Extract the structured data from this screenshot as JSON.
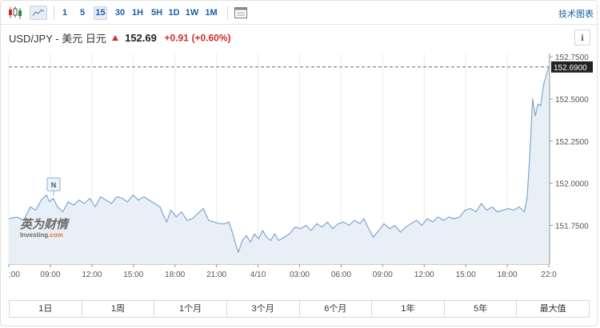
{
  "toolbar": {
    "intervals": [
      "1",
      "5",
      "15",
      "30",
      "1H",
      "5H",
      "1D",
      "1W",
      "1M"
    ],
    "active_interval": "15",
    "tech_chart_label": "技术图表"
  },
  "header": {
    "pair": "USD/JPY - 美元 日元",
    "price": "152.69",
    "change": "+0.91",
    "change_pct": "(+0.60%)",
    "info_label": "i"
  },
  "watermark": {
    "brand_cn": "英为财情",
    "brand_en": "Investing",
    "brand_suffix": ".com"
  },
  "news_marker": "N",
  "ranges": [
    "1日",
    "1周",
    "1个月",
    "3个月",
    "6个月",
    "1年",
    "5年",
    "最大值"
  ],
  "colors": {
    "line": "#7fa6cf",
    "fill": "#e9eff6",
    "up": "#d12b2b",
    "accent": "#1a5fa8",
    "last_price_bg": "#222222"
  },
  "chart_data": {
    "type": "area",
    "x_labels": [
      ":00",
      "09:00",
      "12:00",
      "15:00",
      "18:00",
      "21:00",
      "4/10",
      "03:00",
      "06:00",
      "09:00",
      "12:00",
      "15:00",
      "18:00",
      "22:0"
    ],
    "y_ticks": [
      "152.7500",
      "152.5000",
      "152.2500",
      "152.0000",
      "151.7500"
    ],
    "ylim": [
      151.52,
      152.77
    ],
    "last_price": "152.6900",
    "last_price_value": 152.69,
    "grid": "vertical",
    "x_unit": "hours from first label",
    "x_range": [
      0,
      40
    ],
    "series": [
      {
        "x": [
          0,
          0.6,
          1.1,
          1.6,
          2.0,
          2.4,
          2.8,
          3.0,
          3.3,
          3.6,
          4.0,
          4.4,
          4.8,
          5.2,
          5.6,
          6.0,
          6.4,
          6.8,
          7.2,
          7.6,
          8.0,
          8.4,
          8.8,
          9.2,
          9.6,
          10.0,
          10.4,
          10.8,
          11.2,
          11.4,
          11.7,
          12.0,
          12.4,
          12.8,
          13.2,
          13.6,
          14.0,
          14.4,
          14.8,
          15.2,
          15.6,
          16.0,
          16.3,
          16.6,
          16.8,
          17.0,
          17.3,
          17.6,
          17.9,
          18.2,
          18.5,
          18.8,
          19.1,
          19.4,
          19.7,
          20.0,
          20.4,
          20.8,
          21.2,
          21.6,
          22.0,
          22.4,
          22.8,
          23.2,
          23.6,
          24.0,
          24.4,
          24.8,
          25.2,
          25.6,
          26.0,
          26.3,
          26.6,
          27.0,
          27.4,
          27.8,
          28.2,
          28.6,
          29.0,
          29.4,
          29.8,
          30.2,
          30.6,
          31.0,
          31.4,
          31.8,
          32.2,
          32.6,
          33.0,
          33.4,
          33.8,
          34.2,
          34.6,
          35.0,
          35.4,
          35.8,
          36.2,
          36.6,
          37.0,
          37.4,
          37.8,
          38.2,
          38.4,
          38.6,
          38.8,
          39.0,
          39.2,
          39.4,
          39.6,
          39.8,
          40.0
        ],
        "values": [
          151.79,
          151.8,
          151.78,
          151.86,
          151.84,
          151.9,
          151.93,
          151.89,
          151.91,
          151.86,
          151.83,
          151.89,
          151.87,
          151.9,
          151.88,
          151.91,
          151.86,
          151.92,
          151.9,
          151.88,
          151.92,
          151.91,
          151.89,
          151.93,
          151.9,
          151.92,
          151.9,
          151.88,
          151.86,
          151.82,
          151.77,
          151.84,
          151.8,
          151.83,
          151.78,
          151.79,
          151.82,
          151.85,
          151.78,
          151.77,
          151.76,
          151.76,
          151.77,
          151.7,
          151.64,
          151.59,
          151.66,
          151.69,
          151.65,
          151.7,
          151.67,
          151.72,
          151.68,
          151.66,
          151.7,
          151.66,
          151.68,
          151.7,
          151.74,
          151.73,
          151.75,
          151.72,
          151.76,
          151.74,
          151.77,
          151.73,
          151.76,
          151.77,
          151.75,
          151.78,
          151.76,
          151.79,
          151.74,
          151.68,
          151.72,
          151.76,
          151.73,
          151.75,
          151.71,
          151.74,
          151.76,
          151.78,
          151.75,
          151.79,
          151.77,
          151.8,
          151.78,
          151.8,
          151.79,
          151.8,
          151.84,
          151.85,
          151.83,
          151.88,
          151.84,
          151.86,
          151.83,
          151.84,
          151.85,
          151.84,
          151.86,
          151.83,
          151.92,
          152.18,
          152.5,
          152.4,
          152.47,
          152.46,
          152.58,
          152.64,
          152.69
        ]
      }
    ]
  }
}
